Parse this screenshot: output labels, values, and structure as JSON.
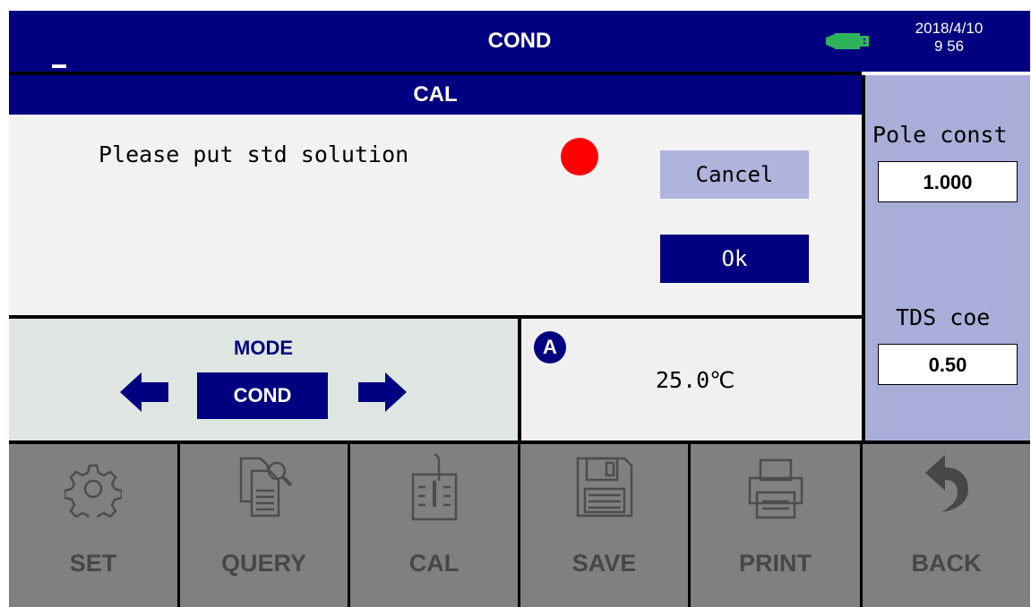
{
  "header": {
    "title": "COND",
    "date": "2018/4/10",
    "time": "9 56",
    "underscore": "_"
  },
  "dialog": {
    "title": "CAL",
    "prompt": "Please put std solution",
    "cancel_label": "Cancel",
    "ok_label": "Ok",
    "indicator_color": "#ff0000"
  },
  "right_panel": {
    "pole_label": "Pole const",
    "pole_value": "1.000",
    "tds_label": "TDS coe",
    "tds_value": "0.50"
  },
  "mode": {
    "label": "MODE",
    "value": "COND"
  },
  "temperature": {
    "badge": "A",
    "value": "25.0℃"
  },
  "toolbar": {
    "items": [
      {
        "label": "SET",
        "icon": "gear-icon"
      },
      {
        "label": "QUERY",
        "icon": "query-icon"
      },
      {
        "label": "CAL",
        "icon": "beaker-icon"
      },
      {
        "label": "SAVE",
        "icon": "floppy-icon"
      },
      {
        "label": "PRINT",
        "icon": "printer-icon"
      },
      {
        "label": "BACK",
        "icon": "back-arrow-icon"
      }
    ]
  },
  "colors": {
    "header_bg": "#000080",
    "panel_bg": "#a9aed9",
    "toolbar_bg": "#808080",
    "usb_green": "#2fb35a"
  }
}
